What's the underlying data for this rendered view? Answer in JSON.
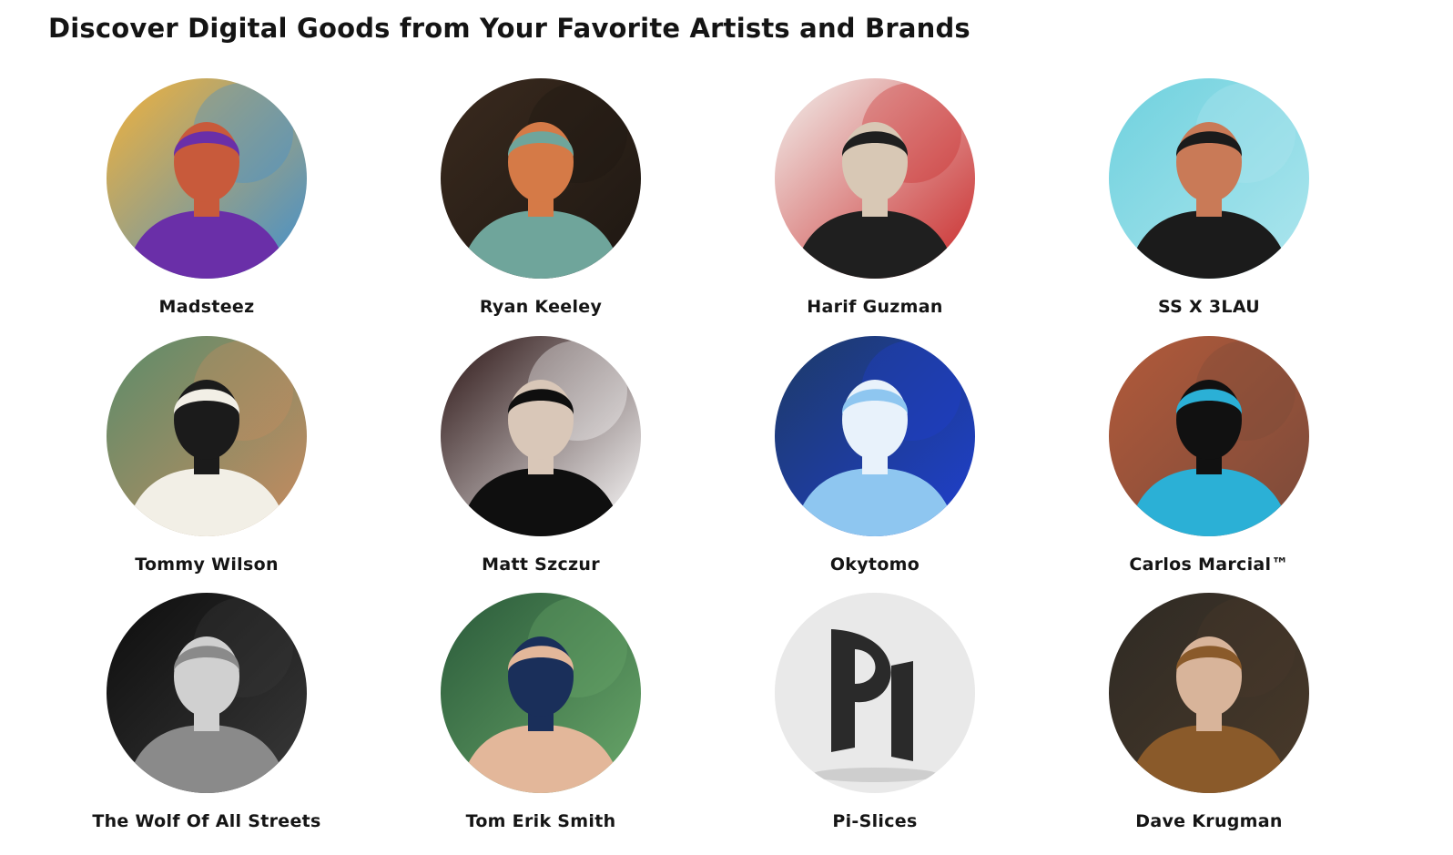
{
  "header": {
    "title": "Discover Digital Goods from Your Favorite Artists and Brands"
  },
  "artists": [
    {
      "name": "Madsteez",
      "avatar": "artist-photo",
      "colors": [
        "#f3b23a",
        "#6a2fa8",
        "#c85a3b",
        "#3f8fd0"
      ]
    },
    {
      "name": "Ryan Keeley",
      "avatar": "artist-photo",
      "colors": [
        "#3a2a1e",
        "#6fa59b",
        "#d57a47",
        "#1d1712"
      ]
    },
    {
      "name": "Harif Guzman",
      "avatar": "artist-photo",
      "colors": [
        "#f2f1ee",
        "#1f1f1f",
        "#d8c8b5",
        "#c92828"
      ]
    },
    {
      "name": "SS X 3LAU",
      "avatar": "artist-photo",
      "colors": [
        "#6fd1de",
        "#1b1b1b",
        "#c97a57",
        "#aee6ee"
      ]
    },
    {
      "name": "Tommy Wilson",
      "avatar": "artist-photo",
      "colors": [
        "#5b8c6a",
        "#f2efe6",
        "#1b1b1b",
        "#c98b5f"
      ]
    },
    {
      "name": "Matt Szczur",
      "avatar": "artist-photo",
      "colors": [
        "#2b1414",
        "#0f0f0f",
        "#d9c7b8",
        "#ffffff"
      ]
    },
    {
      "name": "Okytomo",
      "avatar": "artist-photo",
      "colors": [
        "#1d3a66",
        "#8ec6f0",
        "#e8f2fb",
        "#1f3fd0"
      ]
    },
    {
      "name": "Carlos Marcial™",
      "avatar": "artist-photo",
      "colors": [
        "#b25a3a",
        "#2bb0d6",
        "#111111",
        "#7a4a3a"
      ]
    },
    {
      "name": "The Wolf Of All Streets",
      "avatar": "artist-photo",
      "colors": [
        "#0d0d0d",
        "#8a8a8a",
        "#d0d0d0",
        "#3a3a3a"
      ]
    },
    {
      "name": "Tom Erik Smith",
      "avatar": "artist-photo",
      "colors": [
        "#2a5a3a",
        "#e3b79a",
        "#1a2f5a",
        "#6aa86a"
      ]
    },
    {
      "name": "Pi-Slices",
      "avatar": "logo-mark",
      "colors": [
        "#e9e9e9",
        "#2a2a2a",
        "#bdbdbd",
        "#ffffff"
      ]
    },
    {
      "name": "Dave Krugman",
      "avatar": "artist-photo",
      "colors": [
        "#2e2a24",
        "#8a5a2a",
        "#d8b49a",
        "#4a3a2a"
      ]
    }
  ]
}
